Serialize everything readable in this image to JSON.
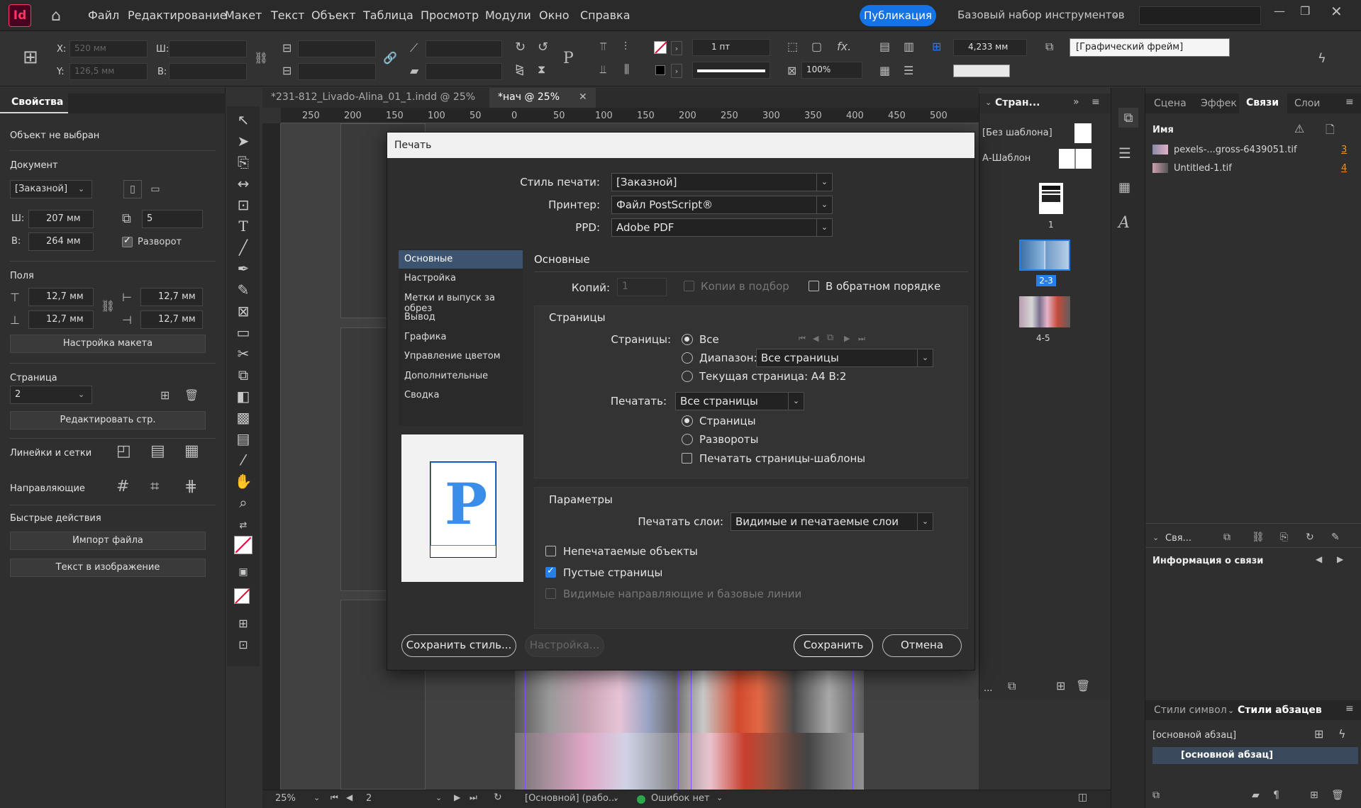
{
  "app": {
    "logo": "Id",
    "publish_label": "Публикация",
    "workspace_label": "Базовый набор инструментов"
  },
  "menu": [
    "Файл",
    "Редактирование",
    "Макет",
    "Текст",
    "Объект",
    "Таблица",
    "Просмотр",
    "Модули",
    "Окно",
    "Справка"
  ],
  "controlbar": {
    "x_label": "X:",
    "y_label": "Y:",
    "w_label": "Ш:",
    "h_label": "В:",
    "x_value": "520 мм",
    "y_value": "126,5 мм",
    "stroke_weight": "1 пт",
    "opacity": "100%",
    "spacing": "4,233 мм",
    "frame_style": "[Графический фрейм]"
  },
  "tabs": [
    {
      "label": "*231-812_Livado-Alina_01_1.indd @ 25%",
      "active": false
    },
    {
      "label": "*нач @ 25%",
      "active": true
    }
  ],
  "ruler_ticks": [
    "250",
    "200",
    "150",
    "100",
    "50",
    "0",
    "50",
    "100",
    "150",
    "200",
    "250",
    "300",
    "350",
    "400",
    "450",
    "500"
  ],
  "properties": {
    "tab": "Свойства",
    "no_selection": "Объект не выбран",
    "document_title": "Документ",
    "preset": "[Заказной]",
    "width_label": "Ш:",
    "width": "207 мм",
    "height_label": "В:",
    "height": "264 мм",
    "pages_count": "5",
    "spread_label": "Разворот",
    "margins_title": "Поля",
    "margin_top": "12,7 мм",
    "margin_bottom": "12,7 мм",
    "margin_left": "12,7 мм",
    "margin_right": "12,7 мм",
    "layout_button": "Настройка макета",
    "page_title": "Страница",
    "page_value": "2",
    "edit_page_button": "Редактировать стр.",
    "rulers_title": "Линейки и сетки",
    "guides_title": "Направляющие",
    "quick_actions_title": "Быстрые действия",
    "import_button": "Импорт файла",
    "text_in_image_button": "Текст в изображение"
  },
  "pages_panel": {
    "tab": "Стран...",
    "no_master": "[Без шаблона]",
    "a_master": "А-Шаблон",
    "pages": [
      {
        "label": "1"
      },
      {
        "label": "2-3"
      },
      {
        "label": "4-5"
      }
    ]
  },
  "right_panel": {
    "tabs": [
      "Сцена",
      "Эффек",
      "Связи",
      "Слои"
    ],
    "active_tab": "Связи",
    "name_header": "Имя",
    "links": [
      {
        "name": "pexels-...gross-6439051.tif",
        "page": "3"
      },
      {
        "name": "Untitled-1.tif",
        "page": "4"
      }
    ],
    "collapse_label": "Свя...",
    "link_info": "Информация о связи",
    "styles_tabs": [
      "Стили символ",
      "Стили абзацев"
    ],
    "base_style": "[основной абзац]",
    "selected_style": "[основной абзац]"
  },
  "statusbar": {
    "zoom": "25%",
    "page": "2",
    "style": "[Основной] (рабо...",
    "errors": "Ошибок нет"
  },
  "dialog": {
    "title": "Печать",
    "style_label": "Стиль печати:",
    "style_value": "[Заказной]",
    "printer_label": "Принтер:",
    "printer_value": "Файл PostScript®",
    "ppd_label": "PPD:",
    "ppd_value": "Adobe PDF",
    "nav": [
      "Основные",
      "Настройка",
      "Метки и выпуск за обрез",
      "Вывод",
      "Графика",
      "Управление цветом",
      "Дополнительные",
      "Сводка"
    ],
    "nav_active": 0,
    "section_title": "Основные",
    "copies_label": "Копий:",
    "copies_value": "1",
    "collate_label": "Копии в подбор",
    "reverse_label": "В обратном порядке",
    "pages_section": "Страницы",
    "pages_label": "Страницы:",
    "all_label": "Все",
    "range_label": "Диапазон:",
    "range_value": "Все страницы",
    "current_label": "Текущая страница: А4 В:2",
    "print_label": "Печатать:",
    "print_value": "Все страницы",
    "pages_radio": "Страницы",
    "spreads_radio": "Развороты",
    "masters_label": "Печатать страницы-шаблоны",
    "params_section": "Параметры",
    "layers_label": "Печатать слои:",
    "layers_value": "Видимые и печатаемые слои",
    "nonprint_label": "Непечатаемые объекты",
    "blank_label": "Пустые страницы",
    "guides_label": "Видимые направляющие и базовые линии",
    "preview_letter": "P",
    "save_style_button": "Сохранить стиль...",
    "setup_button": "Настройка...",
    "save_button": "Сохранить",
    "cancel_button": "Отмена"
  },
  "colors": {
    "accent": "#2680eb",
    "app_logo": "#ff3366",
    "dialog_bg": "#2e2e2e",
    "preview_p": "#3a8eea"
  }
}
